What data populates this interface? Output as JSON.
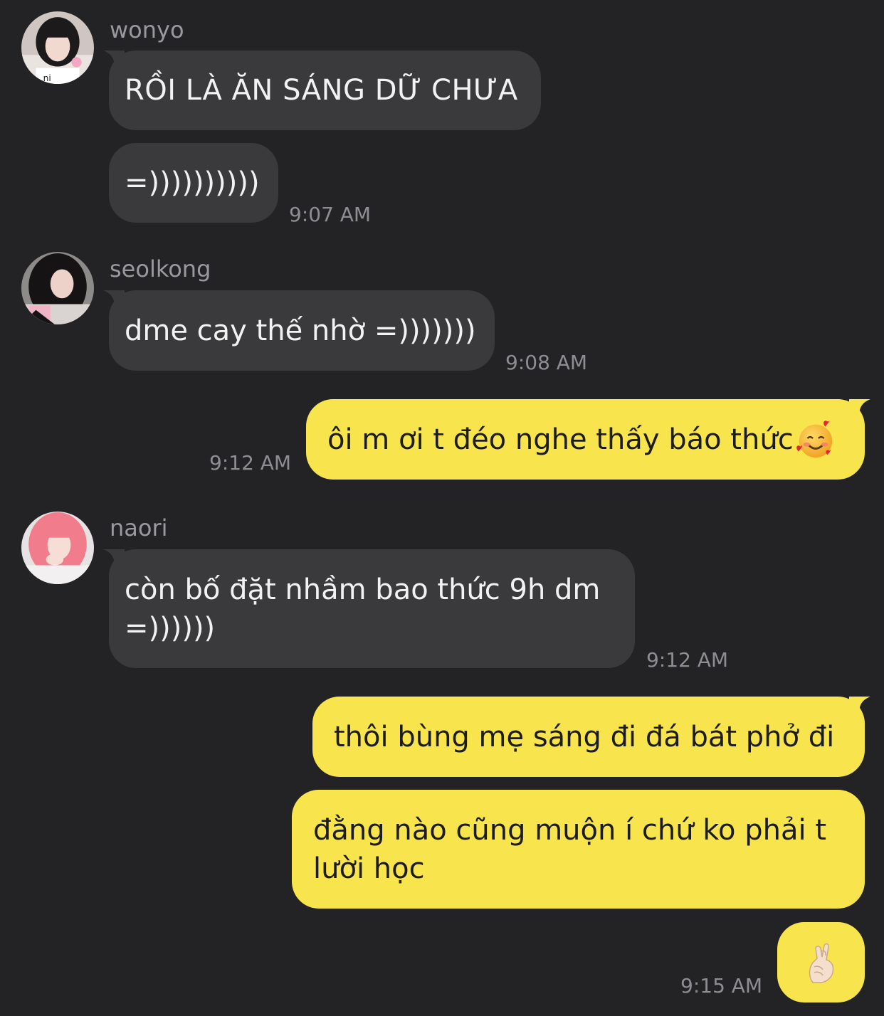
{
  "colors": {
    "background": "#232325",
    "incoming_bubble": "#3a3a3c",
    "outgoing_bubble": "#f8e54d",
    "sender_name": "#9a9a9e",
    "timestamp": "#8e8e92"
  },
  "messages": [
    {
      "sender": "wonyo",
      "avatar_icon": "avatar-wonyo",
      "texts": [
        "RỒI LÀ ĂN SÁNG DỮ CHƯA",
        "=))))))))))"
      ],
      "time": "9:07 AM"
    },
    {
      "sender": "seolkong",
      "avatar_icon": "avatar-seolkong",
      "texts": [
        "dme cay thế nhờ =)))))))"
      ],
      "time": "9:08 AM"
    },
    {
      "sender": "me",
      "texts": [
        "ôi m ơi t đéo nghe thấy báo thức"
      ],
      "emoji": "smiling-face-with-hearts",
      "time": "9:12 AM"
    },
    {
      "sender": "naori",
      "avatar_icon": "avatar-naori",
      "texts": [
        "còn bố đặt nhầm bao thức 9h dm =))))))"
      ],
      "time": "9:12 AM"
    },
    {
      "sender": "me",
      "texts": [
        "thôi bùng mẹ sáng đi đá bát phở đi",
        "đằng nào cũng muộn í chứ ko phải t lười học"
      ],
      "emoji_message": "fingers-crossed-hand",
      "time": "9:15 AM"
    }
  ]
}
